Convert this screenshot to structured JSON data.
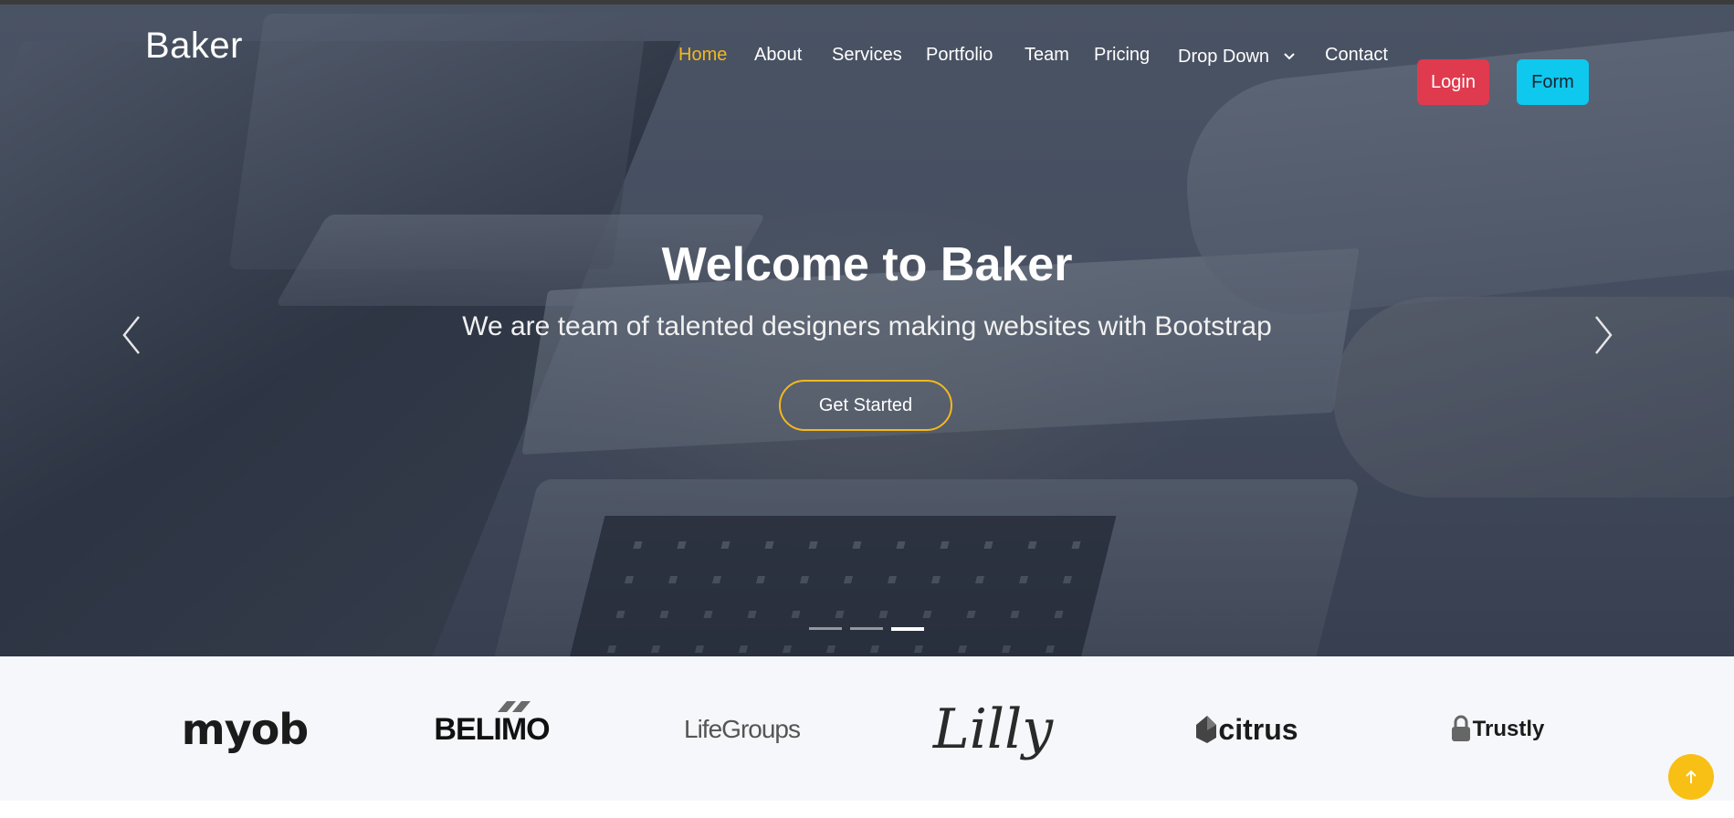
{
  "brand": {
    "name": "Baker"
  },
  "nav": {
    "items": [
      {
        "label": "Home",
        "active": true
      },
      {
        "label": "About"
      },
      {
        "label": "Services"
      },
      {
        "label": "Portfolio"
      },
      {
        "label": "Team"
      },
      {
        "label": "Pricing"
      },
      {
        "label": "Drop Down",
        "icon": "chevron-down-icon"
      },
      {
        "label": "Contact"
      }
    ],
    "login_label": "Login",
    "form_label": "Form"
  },
  "hero": {
    "title": "Welcome to Baker",
    "subtitle": "We are team of talented designers making websites with Bootstrap",
    "cta_label": "Get Started",
    "slide_count": 3,
    "active_slide": 3
  },
  "clients": {
    "logos": [
      "myob",
      "BELIMO",
      "LifeGroups",
      "Lilly",
      "citrus",
      "Trustly"
    ]
  },
  "colors": {
    "accent": "#f5b81c",
    "login": "#e03a4e",
    "form": "#0fc8ee",
    "backtop": "#f8bf14"
  },
  "icons": [
    "chevron-down-icon",
    "chevron-left-icon",
    "chevron-right-icon",
    "arrow-up-icon"
  ]
}
